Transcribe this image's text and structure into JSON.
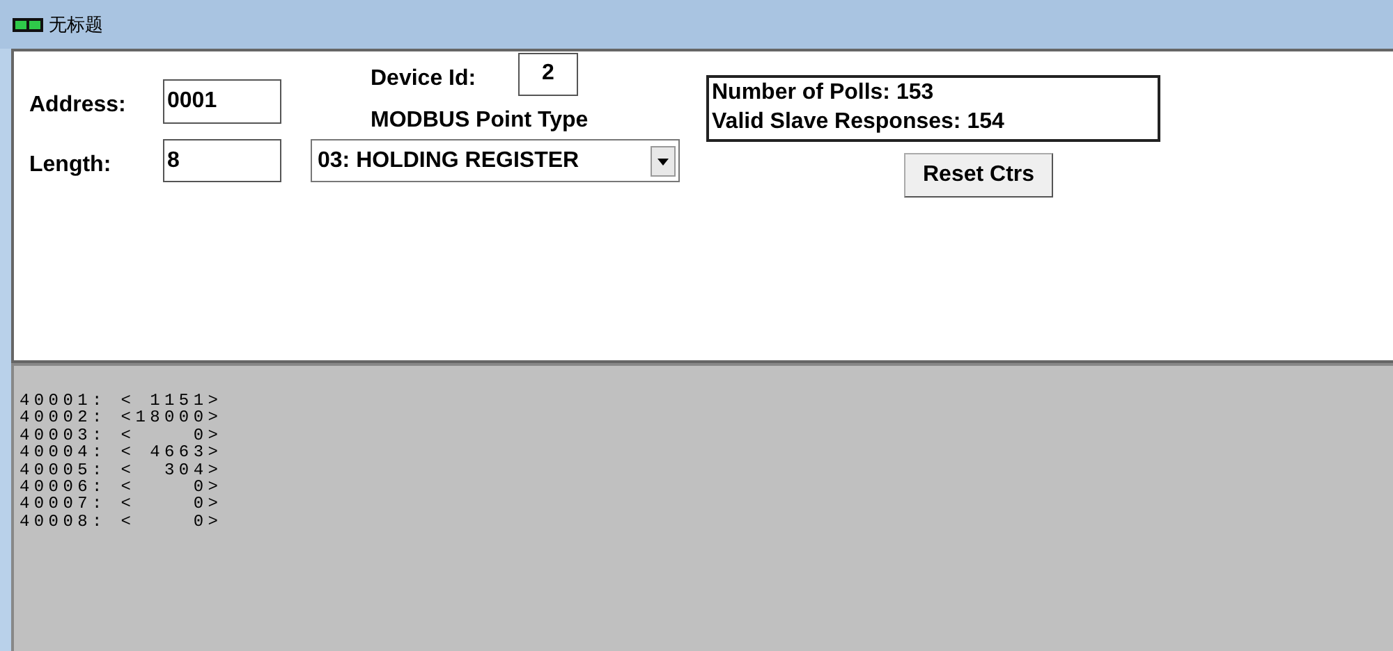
{
  "window": {
    "title": "无标题"
  },
  "form": {
    "address_label": "Address:",
    "address": "0001",
    "length_label": "Length:",
    "length": "8",
    "device_id_label": "Device Id:",
    "device_id": "2",
    "point_type_label": "MODBUS Point Type",
    "point_type": "03: HOLDING REGISTER"
  },
  "stats": [
    "Number of Polls: 153",
    "Valid Slave Responses: 154"
  ],
  "reset_button": "Reset Ctrs",
  "registers": [
    "40001: < 1151>",
    "40002: <18000>",
    "40003: <    0>",
    "40004: < 4663>",
    "40005: <  304>",
    "40006: <    0>",
    "40007: <    0>",
    "40008: <    0>"
  ]
}
